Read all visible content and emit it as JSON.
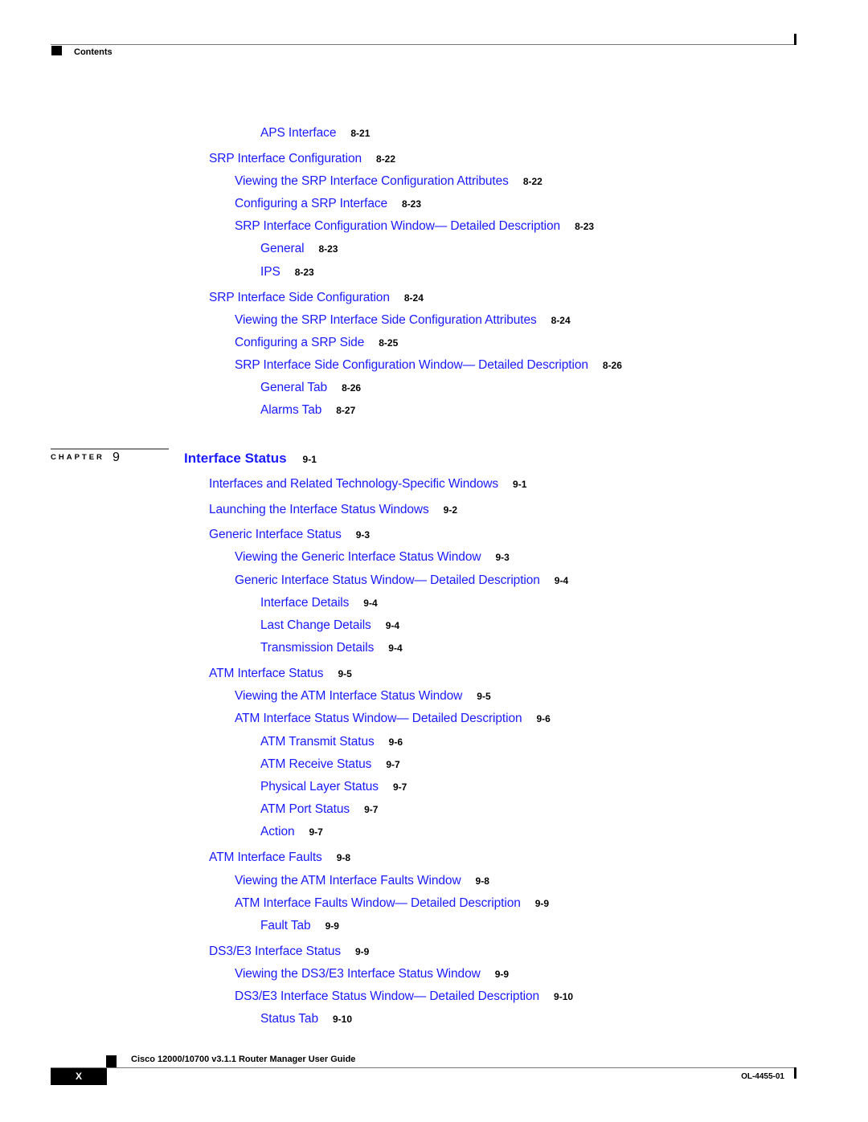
{
  "header": {
    "label": "Contents"
  },
  "entries_before": [
    {
      "level": 3,
      "title": "APS Interface",
      "page": "8-21"
    },
    {
      "level": 1,
      "title": "SRP Interface Configuration",
      "page": "8-22"
    },
    {
      "level": 2,
      "title": "Viewing the SRP Interface Configuration Attributes",
      "page": "8-22"
    },
    {
      "level": 2,
      "title": "Configuring a SRP Interface",
      "page": "8-23"
    },
    {
      "level": 2,
      "title": "SRP Interface Configuration Window— Detailed Description",
      "page": "8-23"
    },
    {
      "level": 3,
      "title": "General",
      "page": "8-23"
    },
    {
      "level": 3,
      "title": "IPS",
      "page": "8-23"
    },
    {
      "level": 1,
      "title": "SRP Interface Side Configuration",
      "page": "8-24"
    },
    {
      "level": 2,
      "title": "Viewing the SRP Interface Side Configuration Attributes",
      "page": "8-24"
    },
    {
      "level": 2,
      "title": "Configuring a SRP Side",
      "page": "8-25"
    },
    {
      "level": 2,
      "title": "SRP Interface Side Configuration Window— Detailed Description",
      "page": "8-26"
    },
    {
      "level": 3,
      "title": "General Tab",
      "page": "8-26"
    },
    {
      "level": 3,
      "title": "Alarms Tab",
      "page": "8-27"
    }
  ],
  "chapter": {
    "label": "CHAPTER",
    "number": "9",
    "title": "Interface Status",
    "page": "9-1"
  },
  "entries_after": [
    {
      "level": 1,
      "title": "Interfaces and Related Technology-Specific Windows",
      "page": "9-1"
    },
    {
      "level": 1,
      "title": "Launching the Interface Status Windows",
      "page": "9-2"
    },
    {
      "level": 1,
      "title": "Generic Interface Status",
      "page": "9-3"
    },
    {
      "level": 2,
      "title": "Viewing the Generic Interface Status Window",
      "page": "9-3"
    },
    {
      "level": 2,
      "title": "Generic Interface Status Window— Detailed Description",
      "page": "9-4"
    },
    {
      "level": 3,
      "title": "Interface Details",
      "page": "9-4"
    },
    {
      "level": 3,
      "title": "Last Change Details",
      "page": "9-4"
    },
    {
      "level": 3,
      "title": "Transmission Details",
      "page": "9-4"
    },
    {
      "level": 1,
      "title": "ATM Interface Status",
      "page": "9-5"
    },
    {
      "level": 2,
      "title": "Viewing the ATM Interface Status Window",
      "page": "9-5"
    },
    {
      "level": 2,
      "title": "ATM Interface Status Window— Detailed Description",
      "page": "9-6"
    },
    {
      "level": 3,
      "title": "ATM Transmit Status",
      "page": "9-6"
    },
    {
      "level": 3,
      "title": "ATM Receive Status",
      "page": "9-7"
    },
    {
      "level": 3,
      "title": "Physical Layer Status",
      "page": "9-7"
    },
    {
      "level": 3,
      "title": "ATM Port Status",
      "page": "9-7"
    },
    {
      "level": 3,
      "title": "Action",
      "page": "9-7"
    },
    {
      "level": 1,
      "title": "ATM Interface Faults",
      "page": "9-8"
    },
    {
      "level": 2,
      "title": "Viewing the ATM Interface Faults Window",
      "page": "9-8"
    },
    {
      "level": 2,
      "title": "ATM Interface Faults Window— Detailed Description",
      "page": "9-9"
    },
    {
      "level": 3,
      "title": "Fault Tab",
      "page": "9-9"
    },
    {
      "level": 1,
      "title": "DS3/E3 Interface Status",
      "page": "9-9"
    },
    {
      "level": 2,
      "title": "Viewing the DS3/E3 Interface Status Window",
      "page": "9-9"
    },
    {
      "level": 2,
      "title": "DS3/E3 Interface Status Window— Detailed Description",
      "page": "9-10"
    },
    {
      "level": 3,
      "title": "Status Tab",
      "page": "9-10"
    }
  ],
  "footer": {
    "guide_title": "Cisco 12000/10700 v3.1.1 Router Manager User Guide",
    "page_number": "X",
    "doc_number": "OL-4455-01"
  }
}
